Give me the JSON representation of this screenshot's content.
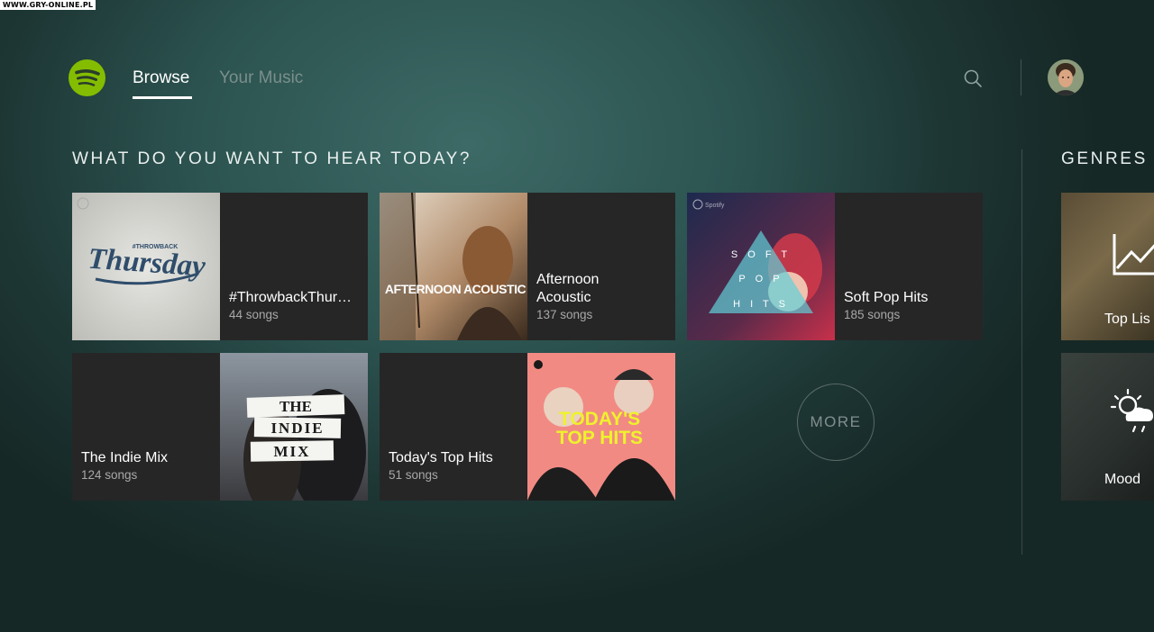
{
  "watermark": "WWW.GRY-ONLINE.PL",
  "nav": {
    "tabs": [
      {
        "label": "Browse",
        "active": true
      },
      {
        "label": "Your Music",
        "active": false
      }
    ]
  },
  "icons": {
    "logo": "spotify-logo",
    "search": "search-icon",
    "avatar": "user-avatar"
  },
  "colors": {
    "brand_green": "#84bd00",
    "card_bg": "#262626",
    "active_tab": "#ffffff",
    "inactive_tab": "#7a8f8c"
  },
  "sections": {
    "main_title": "WHAT DO YOU WANT TO HEAR TODAY?",
    "genres_title": "GENRES &"
  },
  "playlists": [
    {
      "name": "#ThrowbackThur…",
      "count": "44 songs",
      "art_text": [
        "#THROWBACK",
        "Thursday"
      ]
    },
    {
      "name": "Afternoon Acoustic",
      "count": "137 songs",
      "art_text": [
        "AFTERNOON ACOUSTIC"
      ]
    },
    {
      "name": "Soft Pop Hits",
      "count": "185 songs",
      "art_text": [
        "Spotify",
        "S O F T",
        "P O P",
        "H I T S"
      ]
    },
    {
      "name": "The Indie Mix",
      "count": "124 songs",
      "art_text": [
        "THE",
        "INDIE",
        "MIX"
      ]
    },
    {
      "name": "Today's Top Hits",
      "count": "51 songs",
      "art_text": [
        "TODAY'S",
        "TOP HITS"
      ]
    }
  ],
  "more_button": "MORE",
  "genres": [
    {
      "label": "Top Lis",
      "icon": "chart-up-icon"
    },
    {
      "label": "Mood",
      "icon": "weather-icon"
    }
  ]
}
